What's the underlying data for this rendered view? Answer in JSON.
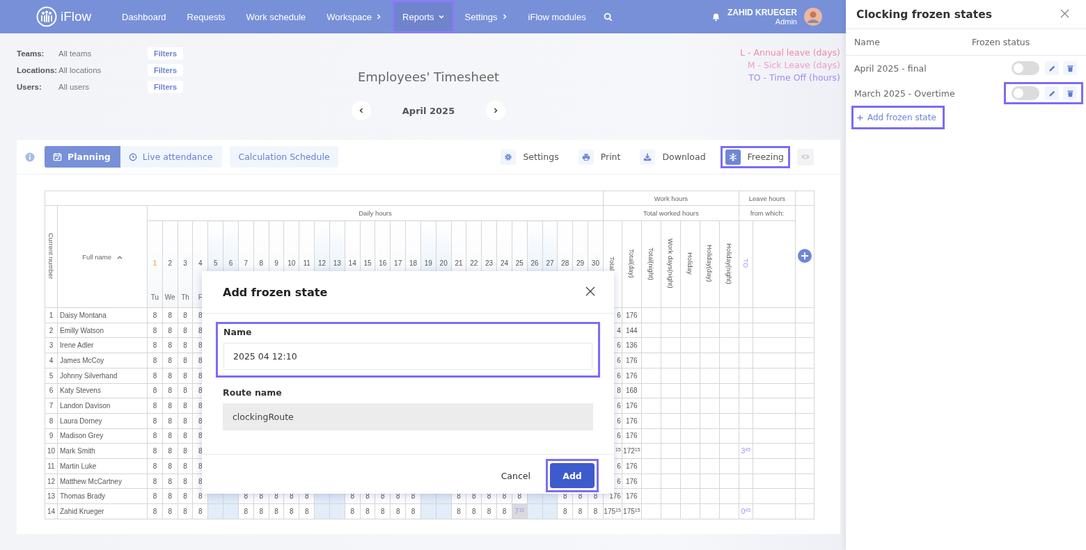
{
  "nav": {
    "logo": "iFlow",
    "items": [
      {
        "label": "Dashboard",
        "kind": "plain",
        "selected": false,
        "highlighted": false
      },
      {
        "label": "Requests",
        "kind": "plain",
        "selected": false,
        "highlighted": false
      },
      {
        "label": "Work schedule",
        "kind": "plain",
        "selected": false,
        "highlighted": false
      },
      {
        "label": "Workspace",
        "kind": "submenu",
        "selected": false,
        "highlighted": false
      },
      {
        "label": "Reports",
        "kind": "dropdown",
        "selected": true,
        "highlighted": true
      },
      {
        "label": "Settings",
        "kind": "submenu",
        "selected": false,
        "highlighted": false
      },
      {
        "label": "iFlow modules",
        "kind": "plain",
        "selected": false,
        "highlighted": false
      }
    ],
    "user": {
      "name": "ZAHID KRUEGER",
      "role": "Admin"
    }
  },
  "filters": [
    {
      "label": "Teams:",
      "value": "All teams",
      "button": "Filters"
    },
    {
      "label": "Locations:",
      "value": "All locations",
      "button": "Filters"
    },
    {
      "label": "Users:",
      "value": "All users",
      "button": "Filters"
    }
  ],
  "title": "Employees' Timesheet",
  "legend": [
    {
      "text": "L - Annual leave (days)",
      "color": "#f08ca4"
    },
    {
      "text": "M - Sick Leave (days)",
      "color": "#f19cc6"
    },
    {
      "text": "TO - Time Off (hours)",
      "color": "#a48cf2"
    }
  ],
  "month": {
    "label": "April 2025"
  },
  "view_tabs": [
    {
      "label": "Planning",
      "kind": "planning",
      "selected": true
    },
    {
      "label": "Live attendance",
      "kind": "live",
      "selected": false
    }
  ],
  "calc_button": "Calculation Schedule",
  "actions": [
    {
      "kind": "settings",
      "label": "Settings",
      "highlighted": false
    },
    {
      "kind": "print",
      "label": "Print",
      "highlighted": false
    },
    {
      "kind": "download",
      "label": "Download",
      "highlighted": false
    },
    {
      "kind": "freeze",
      "label": "Freezing",
      "highlighted": true
    },
    {
      "kind": "visibility",
      "highlighted": false
    }
  ],
  "table": {
    "work_group": "Work hours",
    "leave_group": "Leave hours",
    "daily_group": "Daily hours",
    "worked_group": "Total worked hours",
    "from_which": "from which:",
    "number_header": "Current number",
    "name_header": "Full name",
    "days": [
      {
        "day": "1",
        "weekday": "Tu",
        "weekend": false
      },
      {
        "day": "2",
        "weekday": "We",
        "weekend": false
      },
      {
        "day": "3",
        "weekday": "Th",
        "weekend": false
      },
      {
        "day": "4",
        "weekday": "F",
        "weekend": false
      },
      {
        "day": "5",
        "weekend": true
      },
      {
        "day": "6",
        "weekend": true
      },
      {
        "day": "7",
        "weekend": false
      },
      {
        "day": "8",
        "weekend": false
      },
      {
        "day": "9",
        "weekend": false
      },
      {
        "day": "10",
        "weekend": false
      },
      {
        "day": "11",
        "weekend": false
      },
      {
        "day": "12",
        "weekend": true
      },
      {
        "day": "13",
        "weekend": true
      },
      {
        "day": "14",
        "weekend": false
      },
      {
        "day": "15",
        "weekend": false
      },
      {
        "day": "16",
        "weekend": false
      },
      {
        "day": "17",
        "weekend": false
      },
      {
        "day": "18",
        "weekend": false
      },
      {
        "day": "19",
        "weekend": true
      },
      {
        "day": "20",
        "weekend": true
      },
      {
        "day": "21",
        "weekend": false
      },
      {
        "day": "22",
        "weekend": false
      },
      {
        "day": "23",
        "weekend": false
      },
      {
        "day": "24",
        "weekend": false
      },
      {
        "day": "25",
        "weekend": false
      },
      {
        "day": "26",
        "weekend": true
      },
      {
        "day": "27",
        "weekend": true
      },
      {
        "day": "28",
        "weekend": false
      },
      {
        "day": "29",
        "weekend": false
      },
      {
        "day": "30",
        "weekend": false
      }
    ],
    "total_columns": [
      "Total",
      "Total(day)",
      "Total(night)",
      "Work days(night)",
      "Holiday",
      "Holiday(day)",
      "Holiday(night)"
    ],
    "leave_columns": [
      "TO"
    ],
    "rows": [
      {
        "number": "1",
        "name": "Daisy Montana",
        "days": [
          {
            "value": "8",
            "adjusted": false
          },
          {
            "value": "8",
            "adjusted": false
          },
          {
            "value": "8",
            "adjusted": false
          },
          {
            "value": "8",
            "adjusted": false
          }
        ],
        "total": "6",
        "total_day": "176"
      },
      {
        "number": "2",
        "name": "Emilly Watson",
        "days": [
          {
            "value": "8",
            "adjusted": false
          },
          {
            "value": "8",
            "adjusted": false
          },
          {
            "value": "8",
            "adjusted": false
          },
          {
            "value": "8",
            "adjusted": false
          }
        ],
        "total": "4",
        "total_day": "144"
      },
      {
        "number": "3",
        "name": "Irene Adler",
        "days": [
          {
            "value": "8",
            "adjusted": false
          },
          {
            "value": "8",
            "adjusted": false
          },
          {
            "value": "8",
            "adjusted": false
          },
          {
            "value": "8",
            "adjusted": false
          }
        ],
        "total": "6",
        "total_day": "136"
      },
      {
        "number": "4",
        "name": "James McCoy",
        "days": [
          {
            "value": "8",
            "adjusted": false
          },
          {
            "value": "8",
            "adjusted": false
          },
          {
            "value": "8",
            "adjusted": false
          },
          {
            "value": "8",
            "adjusted": false
          }
        ],
        "total": "6",
        "total_day": "176"
      },
      {
        "number": "5",
        "name": "Johnny Silverhand",
        "days": [
          {
            "value": "8",
            "adjusted": false
          },
          {
            "value": "8",
            "adjusted": false
          },
          {
            "value": "8",
            "adjusted": false
          },
          {
            "value": "8",
            "adjusted": false
          }
        ],
        "total": "6",
        "total_day": "176"
      },
      {
        "number": "6",
        "name": "Katy Stevens",
        "days": [
          {
            "value": "8",
            "adjusted": false
          },
          {
            "value": "8",
            "adjusted": false
          },
          {
            "value": "8",
            "adjusted": false
          },
          {
            "value": "8",
            "adjusted": false
          }
        ],
        "total": "8",
        "total_day": "168"
      },
      {
        "number": "7",
        "name": "Landon Davison",
        "days": [
          {
            "value": "8",
            "adjusted": false
          },
          {
            "value": "8",
            "adjusted": false
          },
          {
            "value": "8",
            "adjusted": false
          },
          {
            "value": "8",
            "adjusted": false
          }
        ],
        "total": "6",
        "total_day": "176"
      },
      {
        "number": "8",
        "name": "Laura Dorney",
        "days": [
          {
            "value": "8",
            "adjusted": false
          },
          {
            "value": "8",
            "adjusted": false
          },
          {
            "value": "8",
            "adjusted": false
          },
          {
            "value": "8",
            "adjusted": false
          }
        ],
        "total": "6",
        "total_day": "176"
      },
      {
        "number": "9",
        "name": "Madison Grey",
        "days": [
          {
            "value": "8",
            "adjusted": false
          },
          {
            "value": "8",
            "adjusted": false
          },
          {
            "value": "8",
            "adjusted": false
          },
          {
            "value": "8",
            "adjusted": false
          }
        ],
        "total": "6",
        "total_day": "176"
      },
      {
        "number": "10",
        "name": "Mark Smith",
        "days": [
          {
            "value": "8",
            "adjusted": false
          },
          {
            "value": "8",
            "adjusted": false
          },
          {
            "value": "8",
            "adjusted": false
          },
          {
            "value": "8",
            "adjusted": false
          }
        ],
        "total": "$^{15}$",
        "total_day": "172$^{15}$",
        "to": "3$^{45}$"
      },
      {
        "number": "11",
        "name": "Martin Luke",
        "days": [
          {
            "value": "8",
            "adjusted": false
          },
          {
            "value": "8",
            "adjusted": false
          },
          {
            "value": "8",
            "adjusted": false
          },
          {
            "value": "8",
            "adjusted": false
          }
        ],
        "total": "6",
        "total_day": "176"
      },
      {
        "number": "12",
        "name": "Matthew McCartney",
        "days": [
          {
            "value": "8",
            "adjusted": false
          },
          {
            "value": "8",
            "adjusted": false
          },
          {
            "value": "8",
            "adjusted": false
          },
          {
            "value": "8",
            "adjusted": false
          }
        ],
        "total": "6",
        "total_day": "176"
      },
      {
        "number": "13",
        "name": "Thomas Brady",
        "days": [
          {
            "kind": "hours",
            "value": "8",
            "adjusted": false
          },
          {
            "kind": "hours",
            "value": "8",
            "adjusted": false
          },
          {
            "kind": "hours",
            "value": "8",
            "adjusted": false
          },
          {
            "kind": "hours",
            "value": "8",
            "adjusted": false
          },
          {
            "kind": "blank"
          },
          {
            "kind": "blank"
          },
          {
            "kind": "hours",
            "value": "8",
            "adjusted": false
          },
          {
            "kind": "hours",
            "value": "8",
            "adjusted": false
          },
          {
            "kind": "hours",
            "value": "8",
            "adjusted": false
          },
          {
            "kind": "hours",
            "value": "8",
            "adjusted": false
          },
          {
            "kind": "hours",
            "value": "8",
            "adjusted": false
          },
          {
            "kind": "blank"
          },
          {
            "kind": "blank"
          },
          {
            "kind": "hours",
            "value": "8",
            "adjusted": false
          },
          {
            "kind": "hours",
            "value": "8",
            "adjusted": false
          },
          {
            "kind": "hours",
            "value": "8",
            "adjusted": false
          },
          {
            "kind": "hours",
            "value": "8",
            "adjusted": false
          },
          {
            "kind": "hours",
            "value": "8",
            "adjusted": false
          },
          {
            "kind": "blank"
          },
          {
            "kind": "blank"
          },
          {
            "kind": "hours",
            "value": "8",
            "adjusted": false
          },
          {
            "kind": "hours",
            "value": "8",
            "adjusted": false
          },
          {
            "kind": "hours",
            "value": "8",
            "adjusted": false
          },
          {
            "kind": "hours",
            "value": "8",
            "adjusted": false
          },
          {
            "kind": "hours",
            "value": "8",
            "adjusted": false
          },
          {
            "kind": "blank"
          },
          {
            "kind": "blank"
          },
          {
            "kind": "hours",
            "value": "8",
            "adjusted": false
          },
          {
            "kind": "hours",
            "value": "8",
            "adjusted": false
          },
          {
            "kind": "hours",
            "value": "8",
            "adjusted": false
          }
        ],
        "total": "176",
        "total_day": "176"
      },
      {
        "number": "14",
        "name": "Zahid Krueger",
        "days": [
          {
            "kind": "hours",
            "value": "8",
            "adjusted": false
          },
          {
            "kind": "hours",
            "value": "8",
            "adjusted": false
          },
          {
            "kind": "hours",
            "value": "8",
            "adjusted": false
          },
          {
            "kind": "hours",
            "value": "8",
            "adjusted": false
          },
          {
            "kind": "blank"
          },
          {
            "kind": "blank"
          },
          {
            "kind": "hours",
            "value": "8",
            "adjusted": false
          },
          {
            "kind": "hours",
            "value": "8",
            "adjusted": false
          },
          {
            "kind": "hours",
            "value": "8",
            "adjusted": false
          },
          {
            "kind": "hours",
            "value": "8",
            "adjusted": false
          },
          {
            "kind": "hours",
            "value": "8",
            "adjusted": false
          },
          {
            "kind": "blank"
          },
          {
            "kind": "blank"
          },
          {
            "kind": "hours",
            "value": "8",
            "adjusted": false
          },
          {
            "kind": "hours",
            "value": "8",
            "adjusted": false
          },
          {
            "kind": "hours",
            "value": "8",
            "adjusted": false
          },
          {
            "kind": "hours",
            "value": "8",
            "adjusted": false
          },
          {
            "kind": "hours",
            "value": "8",
            "adjusted": false
          },
          {
            "kind": "blank"
          },
          {
            "kind": "blank"
          },
          {
            "kind": "hours",
            "value": "8",
            "adjusted": false
          },
          {
            "kind": "hours",
            "value": "8",
            "adjusted": false
          },
          {
            "kind": "hours",
            "value": "8",
            "adjusted": false
          },
          {
            "kind": "hours",
            "value": "8",
            "adjusted": false
          },
          {
            "kind": "hours",
            "value": "7$^{15}$",
            "adjusted": true
          },
          {
            "kind": "blank"
          },
          {
            "kind": "blank"
          },
          {
            "kind": "hours",
            "value": "8",
            "adjusted": false
          },
          {
            "kind": "hours",
            "value": "8",
            "adjusted": false
          },
          {
            "kind": "hours",
            "value": "8",
            "adjusted": false
          }
        ],
        "total": "175$^{15}$",
        "total_day": "175$^{15}$",
        "to": "0$^{45}$"
      }
    ]
  },
  "panel": {
    "title": "Clocking frozen states",
    "columns": [
      "Name",
      "Frozen status"
    ],
    "rows": [
      {
        "name": "April 2025 - final",
        "on": false,
        "highlighted": false
      },
      {
        "name": "March 2025 - Overtime",
        "on": false,
        "highlighted": true
      }
    ],
    "add_link": {
      "label": "Add frozen state",
      "highlighted": true
    }
  },
  "modal": {
    "title": "Add frozen state",
    "name_field": {
      "label": "Name",
      "value": "2025 04 12:10",
      "highlighted": true
    },
    "route_field": {
      "label": "Route name",
      "value": "clockingRoute",
      "disabled": true
    },
    "cancel": "Cancel",
    "add": {
      "label": "Add",
      "highlighted": true
    }
  }
}
